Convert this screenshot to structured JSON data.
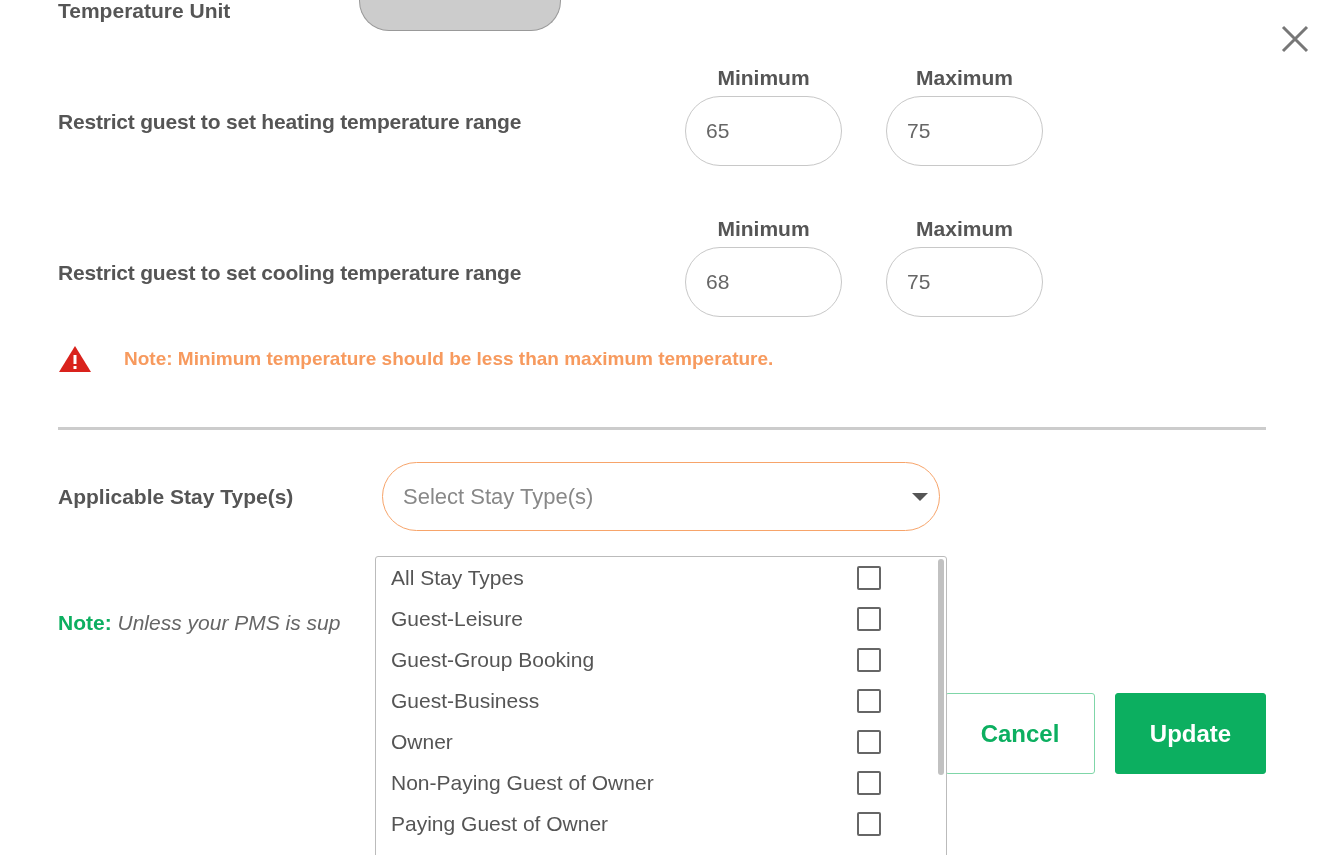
{
  "temperature_unit": {
    "label": "Temperature Unit",
    "disabled": true
  },
  "ranges": [
    {
      "label": "Restrict guest to set heating temperature range",
      "min_label": "Minimum",
      "min": "65",
      "max_label": "Maximum",
      "max": "75"
    },
    {
      "label": "Restrict guest to set cooling temperature range",
      "min_label": "Minimum",
      "min": "68",
      "max_label": "Maximum",
      "max": "75"
    }
  ],
  "warning": "Note: Minimum temperature should be less than maximum temperature.",
  "stay_type": {
    "label": "Applicable Stay Type(s)",
    "placeholder": "Select Stay Type(s)",
    "expanded": true,
    "options": [
      {
        "label": "All Stay Types",
        "checked": false
      },
      {
        "label": "Guest-Leisure",
        "checked": false
      },
      {
        "label": "Guest-Group Booking",
        "checked": false
      },
      {
        "label": "Guest-Business",
        "checked": false
      },
      {
        "label": "Owner",
        "checked": false
      },
      {
        "label": "Non-Paying Guest of Owner",
        "checked": false
      },
      {
        "label": "Paying Guest of Owner",
        "checked": false
      }
    ]
  },
  "note": {
    "label": "Note:",
    "text": "Unless your PMS is sup"
  },
  "buttons": [
    {
      "label": "Cancel",
      "kind": "secondary"
    },
    {
      "label": "Update",
      "kind": "primary"
    }
  ]
}
